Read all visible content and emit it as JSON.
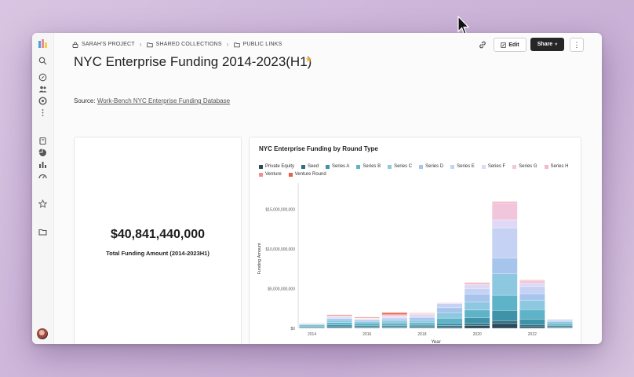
{
  "breadcrumb": [
    "SARAH'S PROJECT",
    "SHARED COLLECTIONS",
    "PUBLIC LINKS"
  ],
  "page_title": "NYC Enterprise Funding 2014-2023(H1)",
  "toolbar": {
    "edit_label": "Edit",
    "share_label": "Share",
    "more_label": "⋮"
  },
  "source": {
    "prefix": "Source:",
    "link_text": "Work-Bench NYC Enterprise Funding Database"
  },
  "kpi": {
    "value": "$40,841,440,000",
    "label": "Total Funding Amount (2014-2023H1)"
  },
  "colors": {
    "accent": "#f0a73a",
    "share_bg": "#262626"
  },
  "chart_data": {
    "type": "bar",
    "stacked": true,
    "title": "NYC Enterprise Funding by Round Type",
    "xlabel": "Year",
    "ylabel": "Funding Amount",
    "categories": [
      "2014",
      "2015",
      "2016",
      "2017",
      "2018",
      "2019",
      "2020",
      "2021",
      "2022",
      "2023"
    ],
    "x_tick_labels": [
      "2014",
      "2016",
      "2018",
      "2020",
      "2022"
    ],
    "y_tick_labels": [
      "$0",
      "$5,000,000,000",
      "$10,000,000,000",
      "$15,000,000,000"
    ],
    "y_tick_values": [
      0,
      5000000000,
      10000000000,
      15000000000
    ],
    "ylim": [
      0,
      17500000000
    ],
    "legend_position": "top",
    "series": [
      {
        "name": "Private Equity",
        "color": "#2b4b5c",
        "values": [
          50000000,
          80000000,
          60000000,
          60000000,
          80000000,
          150000000,
          350000000,
          600000000,
          200000000,
          80000000
        ]
      },
      {
        "name": "Seed",
        "color": "#2f6e80",
        "values": [
          80000000,
          120000000,
          110000000,
          120000000,
          120000000,
          180000000,
          250000000,
          350000000,
          250000000,
          100000000
        ]
      },
      {
        "name": "Series A",
        "color": "#3f93a8",
        "values": [
          120000000,
          220000000,
          200000000,
          200000000,
          200000000,
          350000000,
          700000000,
          1300000000,
          700000000,
          200000000
        ]
      },
      {
        "name": "Series B",
        "color": "#5fb3c8",
        "values": [
          150000000,
          300000000,
          300000000,
          300000000,
          300000000,
          600000000,
          1000000000,
          1900000000,
          1200000000,
          200000000
        ]
      },
      {
        "name": "Series C",
        "color": "#8ec8e0",
        "values": [
          100000000,
          300000000,
          200000000,
          300000000,
          300000000,
          700000000,
          1000000000,
          2700000000,
          1200000000,
          250000000
        ]
      },
      {
        "name": "Series D",
        "color": "#a7c4ec",
        "values": [
          50000000,
          200000000,
          150000000,
          200000000,
          300000000,
          600000000,
          1000000000,
          2000000000,
          800000000,
          150000000
        ]
      },
      {
        "name": "Series E",
        "color": "#c5d2f4",
        "values": [
          30000000,
          150000000,
          100000000,
          150000000,
          200000000,
          500000000,
          700000000,
          3800000000,
          900000000,
          100000000
        ]
      },
      {
        "name": "Series F",
        "color": "#dfd8f6",
        "values": [
          20000000,
          120000000,
          80000000,
          150000000,
          200000000,
          100000000,
          500000000,
          1000000000,
          400000000,
          50000000
        ]
      },
      {
        "name": "Series G",
        "color": "#f1c6dc",
        "values": [
          0,
          50000000,
          40000000,
          100000000,
          100000000,
          50000000,
          100000000,
          2100000000,
          300000000,
          0
        ]
      },
      {
        "name": "Series H",
        "color": "#f5b8c8",
        "values": [
          0,
          20000000,
          20000000,
          50000000,
          40000000,
          0,
          0,
          200000000,
          0,
          0
        ]
      },
      {
        "name": "Venture",
        "color": "#ef8f8f",
        "values": [
          20000000,
          60000000,
          60000000,
          150000000,
          60000000,
          40000000,
          100000000,
          50000000,
          80000000,
          30000000
        ]
      },
      {
        "name": "Venture Round",
        "color": "#e8604c",
        "values": [
          30000000,
          80000000,
          80000000,
          200000000,
          50000000,
          30000000,
          50000000,
          0,
          50000000,
          20000000
        ]
      }
    ]
  }
}
